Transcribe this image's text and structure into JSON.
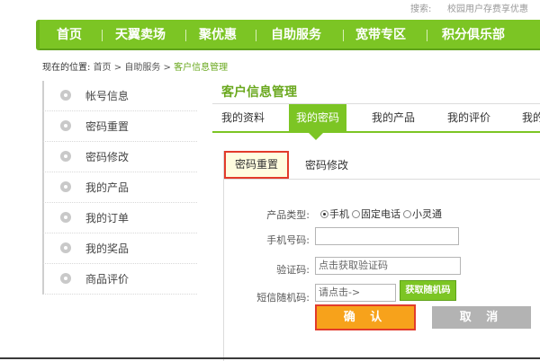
{
  "header": {
    "search_label": "搜索:",
    "search_value": "校园用户存费享优惠"
  },
  "nav": {
    "items": [
      {
        "label": "首页"
      },
      {
        "label": "天翼卖场"
      },
      {
        "label": "聚优惠"
      },
      {
        "label": "自助服务"
      },
      {
        "label": "宽带专区"
      },
      {
        "label": "积分俱乐部"
      }
    ],
    "color": "#7cc524"
  },
  "breadcrumb": {
    "prefix": "现在的位置:",
    "items": [
      "首页",
      "自助服务",
      "客户信息管理"
    ],
    "separator": ">"
  },
  "sidebar": {
    "items": [
      {
        "label": "帐号信息",
        "icon": "account-icon"
      },
      {
        "label": "密码重置",
        "icon": "reset-icon"
      },
      {
        "label": "密码修改",
        "icon": "help-icon"
      },
      {
        "label": "我的产品",
        "icon": "product-icon"
      },
      {
        "label": "我的订单",
        "icon": "check-icon"
      },
      {
        "label": "我的奖品",
        "icon": "prize-icon"
      },
      {
        "label": "商品评价",
        "icon": "review-icon"
      }
    ]
  },
  "main": {
    "title": "客户信息管理",
    "tabs": [
      {
        "label": "我的资料",
        "active": false
      },
      {
        "label": "我的密码",
        "active": true
      },
      {
        "label": "我的产品",
        "active": false
      },
      {
        "label": "我的评价",
        "active": false
      },
      {
        "label": "我的",
        "active": false
      }
    ],
    "subtabs": [
      {
        "label": "密码重置",
        "active": true
      },
      {
        "label": "密码修改",
        "active": false
      }
    ]
  },
  "form": {
    "product_type_label": "产品类型:",
    "product_options": [
      {
        "label": "手机",
        "checked": true
      },
      {
        "label": "固定电话",
        "checked": false
      },
      {
        "label": "小灵通",
        "checked": false
      }
    ],
    "phone_label": "手机号码:",
    "phone_value": "",
    "captcha_label": "验证码:",
    "captcha_placeholder": "点击获取验证码",
    "sms_label": "短信随机码:",
    "sms_placeholder": "请点击->",
    "get_code_button": "获取随机码",
    "confirm_button": "确 认",
    "cancel_button": "取 消"
  },
  "colors": {
    "accent": "#7cc524",
    "confirm": "#f7a21b",
    "highlight_border": "#e23b2b",
    "cancel": "#b3b3b3"
  }
}
